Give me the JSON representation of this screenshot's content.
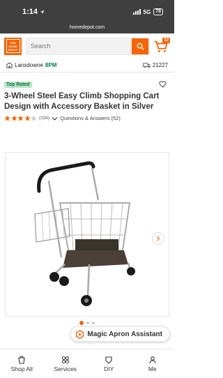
{
  "status_bar": {
    "time": "1:14",
    "network": "5G",
    "battery": "78"
  },
  "url": "homedepot.com",
  "header": {
    "search_placeholder": "Search",
    "cart_count": "12",
    "logo_text": "THE HOME DEPOT"
  },
  "location": {
    "store": "Lansdowne",
    "hours": "8PM",
    "zip": "21227"
  },
  "product": {
    "badge": "Top Rated",
    "title": "3-Wheel Steel Easy Climb Shopping Cart Design with Accessory Basket in Silver",
    "rating": 4,
    "review_count": "(326)",
    "qa_label": "Questions & Answers (52)"
  },
  "carousel": {
    "total": 3,
    "active": 0
  },
  "assistant": {
    "label": "Magic Apron Assistant"
  },
  "nav": [
    {
      "label": "Shop All",
      "icon": "shop-all-icon"
    },
    {
      "label": "Services",
      "icon": "services-icon"
    },
    {
      "label": "DIY",
      "icon": "diy-icon"
    },
    {
      "label": "Me",
      "icon": "me-icon"
    }
  ],
  "colors": {
    "brand": "#f96302",
    "status_bar": "#3f3f3f",
    "store_hours": "#00804a",
    "badge_bg": "#b7e6c8"
  }
}
